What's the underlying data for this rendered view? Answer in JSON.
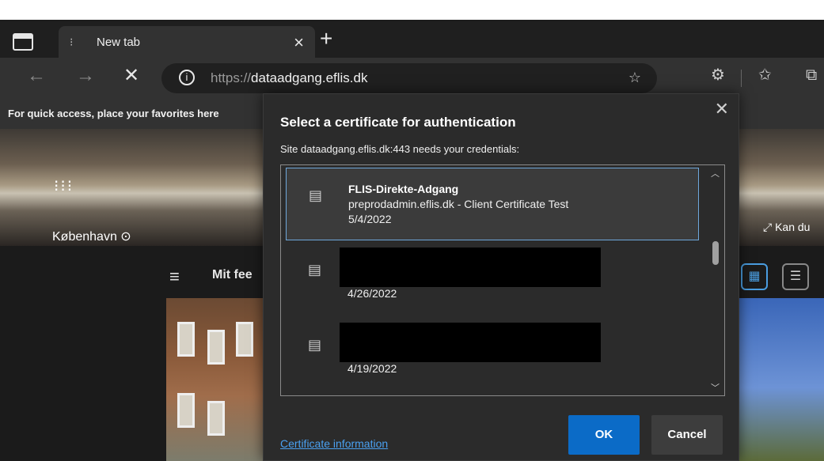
{
  "tabbar": {
    "tab_title": "New tab",
    "close_glyph": "×",
    "new_tab_glyph": "+"
  },
  "toolbar": {
    "url_scheme": "https://",
    "url_host": "dataadgang.eflis.dk"
  },
  "favorites_bar": {
    "text": "For quick access, place your favorites here"
  },
  "page": {
    "location": "København",
    "expand_text": "Kan du",
    "feed_title": "Mit fee"
  },
  "dialog": {
    "title": "Select a certificate for authentication",
    "subtitle": "Site dataadgang.eflis.dk:443 needs your credentials:",
    "certificates": [
      {
        "name": "FLIS-Direkte-Adgang",
        "issuer": "preprodadmin.eflis.dk - Client Certificate Test",
        "date": "5/4/2022",
        "selected": true
      },
      {
        "name": "",
        "issuer": "",
        "date": "4/26/2022",
        "selected": false,
        "redacted": true
      },
      {
        "name": "",
        "issuer": "",
        "date": "4/19/2022",
        "selected": false,
        "redacted": true
      }
    ],
    "cert_info_link": "Certificate information",
    "ok_label": "OK",
    "cancel_label": "Cancel"
  },
  "colors": {
    "accent": "#0b6bc7",
    "link": "#4aa0f0",
    "selection_border": "#6fa8dc"
  }
}
